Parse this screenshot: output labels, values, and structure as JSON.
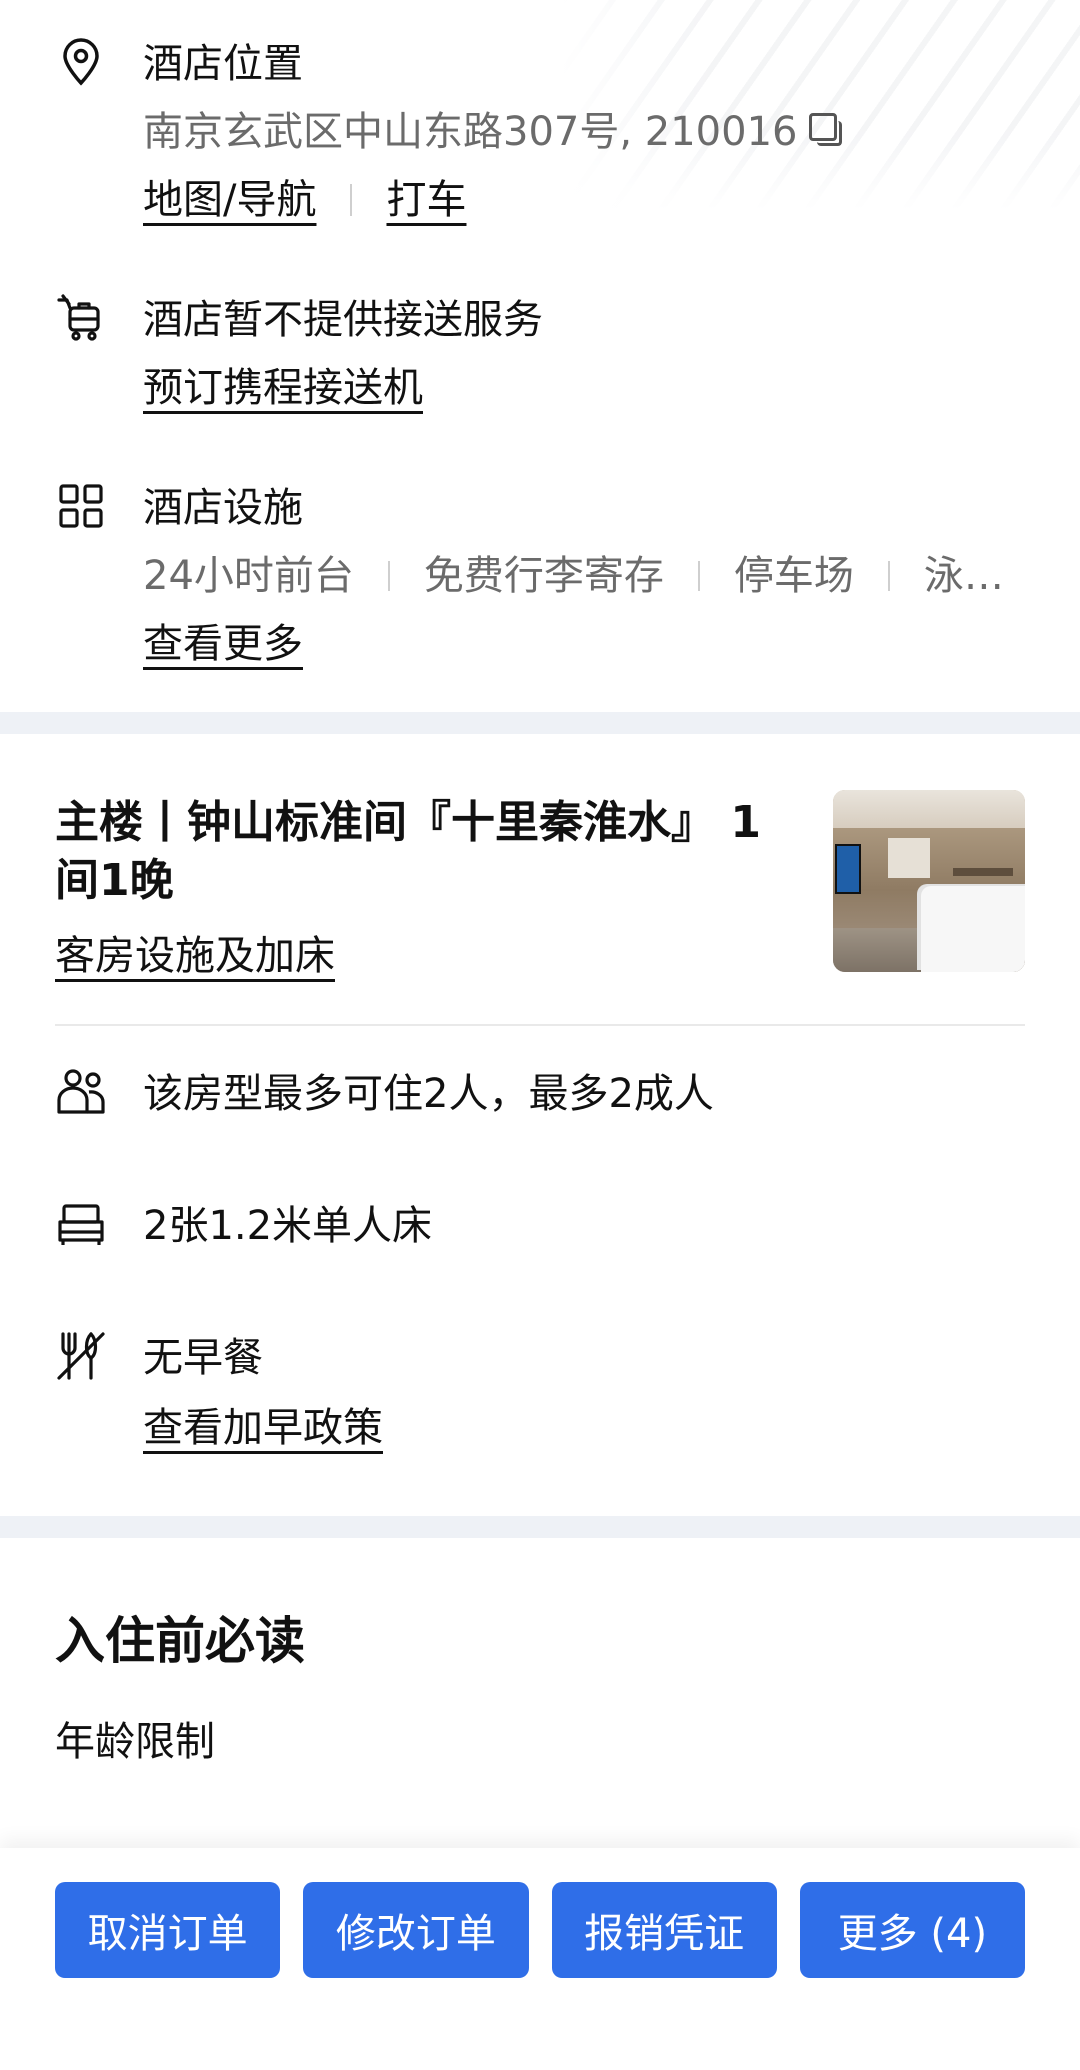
{
  "location": {
    "title": "酒店位置",
    "address": "南京玄武区中山东路307号, 210016",
    "map_link": "地图/导航",
    "taxi_link": "打车"
  },
  "transfer": {
    "title": "酒店暂不提供接送服务",
    "book_link": "预订携程接送机"
  },
  "facilities": {
    "title": "酒店设施",
    "items": [
      "24小时前台",
      "免费行李寄存",
      "停车场",
      "泳…"
    ],
    "more_link": "查看更多"
  },
  "room": {
    "title": "主楼丨钟山标准间『十里秦淮水』 1间1晚",
    "amenities_link": "客房设施及加床",
    "occupancy": "该房型最多可住2人，最多2成人",
    "bed": "2张1.2米单人床",
    "breakfast": "无早餐",
    "breakfast_link": "查看加早政策"
  },
  "notice": {
    "title": "入住前必读",
    "age_limit": "年龄限制"
  },
  "actions": {
    "cancel": "取消订单",
    "modify": "修改订单",
    "invoice": "报销凭证",
    "more": "更多 (4)"
  },
  "colors": {
    "primary_button": "#2f6ee8",
    "section_gap": "#eef1f6",
    "secondary_text": "#6b6b6b"
  },
  "icons": {
    "location": "map-pin-icon",
    "transfer": "airport-cart-icon",
    "facilities": "grid-icon",
    "occupancy": "people-icon",
    "bed": "bed-icon",
    "breakfast": "no-breakfast-icon",
    "copy": "copy-icon"
  }
}
